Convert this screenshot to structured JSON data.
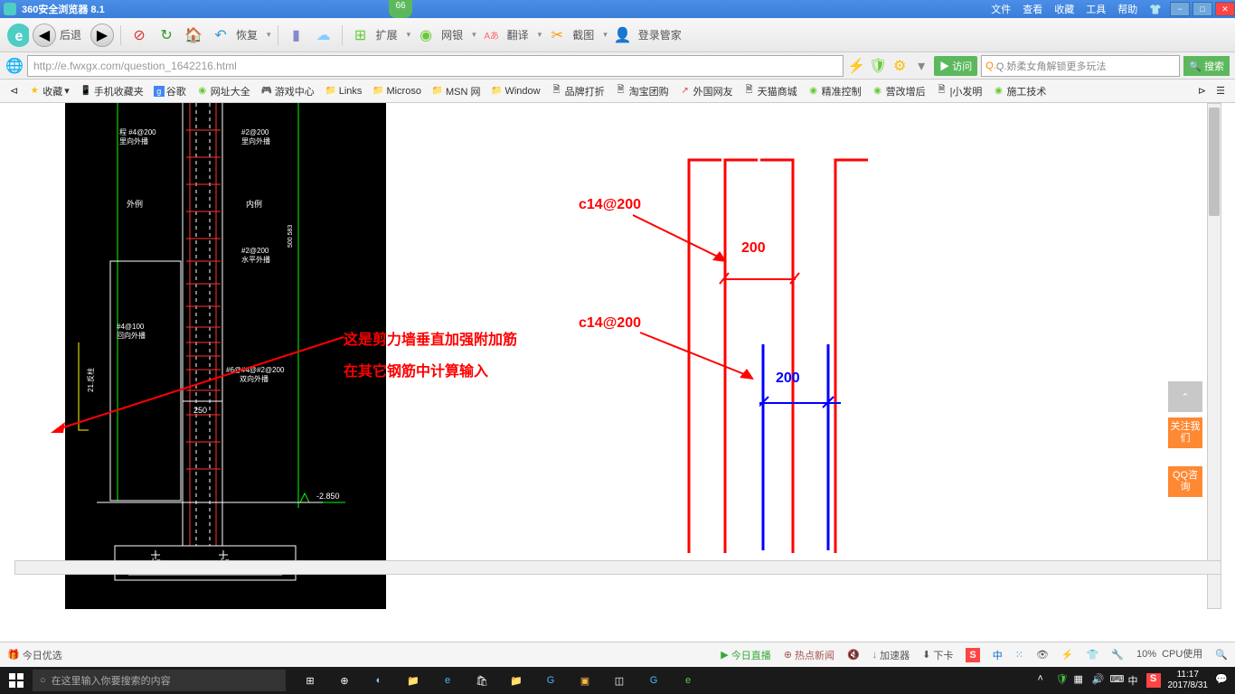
{
  "title_bar": {
    "app": "360安全浏览器 8.1",
    "score": "66"
  },
  "menus": [
    "文件",
    "查看",
    "收藏",
    "工具",
    "帮助"
  ],
  "nav": {
    "back": "后退",
    "restore": "恢复",
    "extend": "扩展",
    "bank": "网银",
    "translate": "翻译",
    "screenshot": "截图",
    "login": "登录管家"
  },
  "url": "http://e.fwxgx.com/question_1642216.html",
  "visit": "访问",
  "search_placeholder": "Q.娇柔女角解锁更多玩法",
  "search_btn": "搜索",
  "bookmarks": {
    "fav": "收藏",
    "items": [
      "手机收藏夹",
      "谷歌",
      "网址大全",
      "游戏中心",
      "Links",
      "Microso",
      "MSN 网",
      "Window",
      "品牌打折",
      "淘宝团购",
      "外国网友",
      "天猫商城",
      "精准控制",
      "营改增后",
      "|小发明",
      "施工技术"
    ]
  },
  "cad": {
    "t1a": "程 #4@200",
    "t1b": "里向外播",
    "t2a": "#2@200",
    "t2b": "里向外播",
    "out": "外例",
    "in": "内例",
    "m1a": "#2@200",
    "m1b": "水平外播",
    "b1a": "#4@100",
    "b1b": "回向外播",
    "b2a": "#6@#4@#2@200",
    "b2b": "双向外播",
    "dim250": "250",
    "elev": "-2.850",
    "ln1": "Ln",
    "ln2": "Ln",
    "side": "21.反柱"
  },
  "annotations": {
    "main1": "这是剪力墙垂直加强附加筋",
    "main2": "在其它钢筋中计算输入",
    "c14_1": "c14@200",
    "v200_1": "200",
    "c14_2": "c14@200",
    "v200_2": "200"
  },
  "side": {
    "top": "⌃",
    "follow": "关注我们",
    "qq": "QQ咨询"
  },
  "status": {
    "today": "今日优选",
    "live": "今日直播",
    "news": "热点新闻",
    "speed": "加速器",
    "down": "下卡",
    "cpu_pct": "10%",
    "cpu_lbl": "CPU使用"
  },
  "ime_badge": "中",
  "taskbar": {
    "search": "在这里输入你要搜索的内容",
    "time": "11:17",
    "date": "2017/8/31"
  }
}
